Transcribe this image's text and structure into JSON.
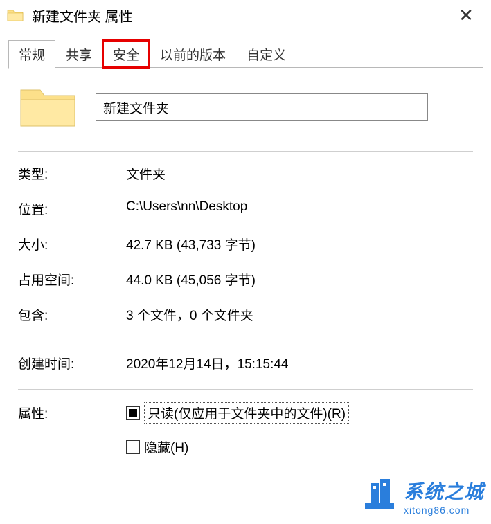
{
  "window": {
    "title": "新建文件夹 属性"
  },
  "tabs": {
    "general": "常规",
    "sharing": "共享",
    "security": "安全",
    "previous_versions": "以前的版本",
    "customize": "自定义"
  },
  "folder_name": "新建文件夹",
  "properties": {
    "type_label": "类型:",
    "type_value": "文件夹",
    "location_label": "位置:",
    "location_value": "C:\\Users\\nn\\Desktop",
    "size_label": "大小:",
    "size_value": "42.7 KB (43,733 字节)",
    "size_on_disk_label": "占用空间:",
    "size_on_disk_value": "44.0 KB (45,056 字节)",
    "contains_label": "包含:",
    "contains_value": "3 个文件，0 个文件夹",
    "created_label": "创建时间:",
    "created_value": "2020年12月14日，15:15:44"
  },
  "attributes": {
    "label": "属性:",
    "readonly_label": "只读(仅应用于文件夹中的文件)(R)",
    "hidden_label": "隐藏(H)"
  },
  "watermark": {
    "text": "系统之城",
    "url": "xitong86.com"
  }
}
